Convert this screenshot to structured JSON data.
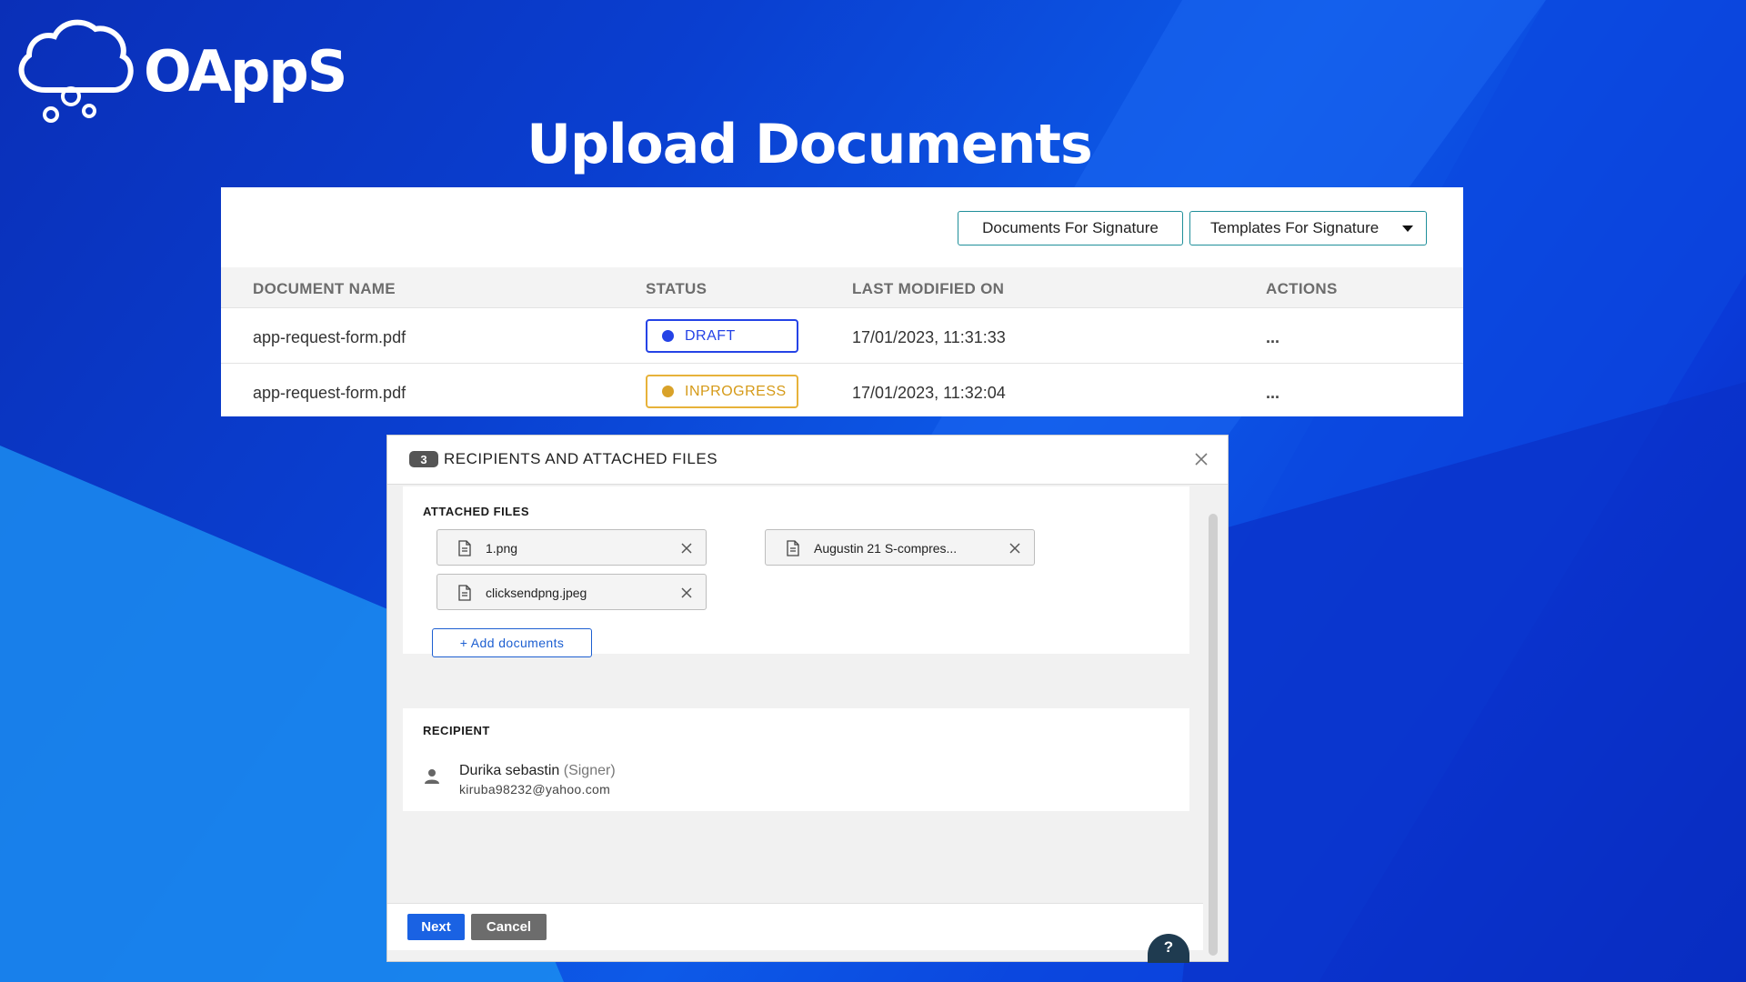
{
  "brand": {
    "name": "OAppS"
  },
  "page": {
    "title": "Upload Documents"
  },
  "toolbar": {
    "documents_for_signature": "Documents For Signature",
    "templates_for_signature": "Templates For Signature"
  },
  "table": {
    "headers": [
      "DOCUMENT NAME",
      "STATUS",
      "LAST MODIFIED ON",
      "ACTIONS"
    ],
    "rows": [
      {
        "name": "app-request-form.pdf",
        "status": "DRAFT",
        "modified": "17/01/2023, 11:31:33",
        "actions": "..."
      },
      {
        "name": "app-request-form.pdf",
        "status": "INPROGRESS",
        "modified": "17/01/2023, 11:32:04",
        "actions": "..."
      }
    ]
  },
  "colors": {
    "draft": "#2543e6",
    "inprogress": "#d9a229",
    "primary": "#1a62e3",
    "secondary": "#6c6c6c"
  },
  "modal": {
    "step": "3",
    "title": "RECIPIENTS AND ATTACHED FILES",
    "attached_label": "ATTACHED FILES",
    "files": [
      "1.png",
      "Augustin 21 S-compres...",
      "clicksendpng.jpeg"
    ],
    "add_documents": "+ Add documents",
    "recipient_label": "RECIPIENT",
    "recipient": {
      "name": "Durika sebastin",
      "role": "(Signer)",
      "email": "kiruba98232@yahoo.com"
    },
    "next": "Next",
    "cancel": "Cancel",
    "help": "?"
  },
  "icons": {
    "logo": "cloud-logo-icon",
    "close": "close-icon",
    "file": "file-icon",
    "remove": "remove-file-icon",
    "person": "person-icon",
    "caret": "caret-down-icon"
  }
}
